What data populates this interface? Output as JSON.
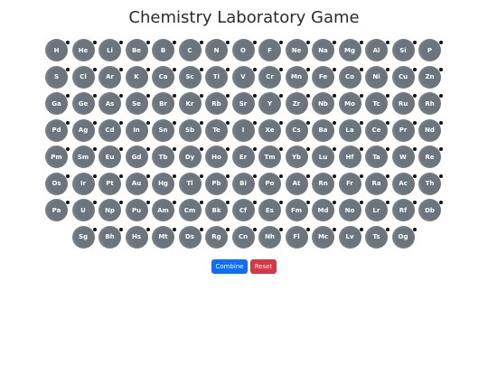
{
  "title": "Chemistry Laboratory Game",
  "buttons": {
    "combine": "Combine",
    "reset": "Reset"
  },
  "colors": {
    "element_bg": "#6c757d",
    "combine": "#0d6efd",
    "reset": "#dc3545"
  },
  "rows": [
    [
      "H",
      "He",
      "Li",
      "Be",
      "B",
      "C",
      "N",
      "O",
      "F",
      "Ne",
      "Na",
      "Mg",
      "Al",
      "Si",
      "P"
    ],
    [
      "S",
      "Cl",
      "Ar",
      "K",
      "Ca",
      "Sc",
      "Ti",
      "V",
      "Cr",
      "Mn",
      "Fe",
      "Co",
      "Ni",
      "Cu",
      "Zn"
    ],
    [
      "Ga",
      "Ge",
      "As",
      "Se",
      "Br",
      "Kr",
      "Rb",
      "Sr",
      "Y",
      "Zr",
      "Nb",
      "Mo",
      "Tc",
      "Ru",
      "Rh"
    ],
    [
      "Pd",
      "Ag",
      "Cd",
      "In",
      "Sn",
      "Sb",
      "Te",
      "I",
      "Xe",
      "Cs",
      "Ba",
      "La",
      "Ce",
      "Pr",
      "Nd"
    ],
    [
      "Pm",
      "Sm",
      "Eu",
      "Gd",
      "Tb",
      "Dy",
      "Ho",
      "Er",
      "Tm",
      "Yb",
      "Lu",
      "Hf",
      "Ta",
      "W",
      "Re"
    ],
    [
      "Os",
      "Ir",
      "Pt",
      "Au",
      "Hg",
      "Tl",
      "Pb",
      "Bi",
      "Po",
      "At",
      "Rn",
      "Fr",
      "Ra",
      "Ac",
      "Th"
    ],
    [
      "Pa",
      "U",
      "Np",
      "Pu",
      "Am",
      "Cm",
      "Bk",
      "Cf",
      "Es",
      "Fm",
      "Md",
      "No",
      "Lr",
      "Rf",
      "Db"
    ],
    [
      "Sg",
      "Bh",
      "Hs",
      "Mt",
      "Ds",
      "Rg",
      "Cn",
      "Nh",
      "Fl",
      "Mc",
      "Lv",
      "Ts",
      "Og"
    ]
  ]
}
